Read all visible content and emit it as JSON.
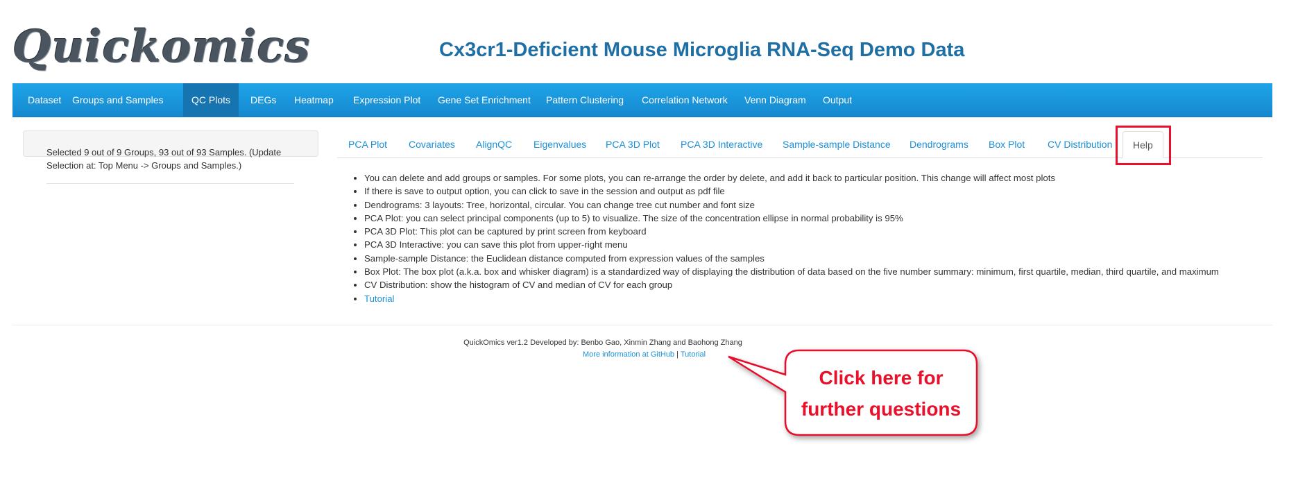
{
  "app": {
    "logo": "Quickomics",
    "title": "Cx3cr1-Deficient Mouse Microglia RNA-Seq Demo Data"
  },
  "nav": {
    "items": [
      "Dataset",
      "Groups and Samples",
      "QC Plots",
      "DEGs",
      "Heatmap",
      "Expression Plot",
      "Gene Set Enrichment",
      "Pattern Clustering",
      "Correlation Network",
      "Venn Diagram",
      "Output"
    ],
    "active": "QC Plots"
  },
  "sidebar": {
    "selection_text": "Selected 9 out of 9 Groups, 93 out of 93 Samples. (Update Selection at: Top Menu -> Groups and Samples.)"
  },
  "tabs": {
    "items": [
      "PCA Plot",
      "Covariates",
      "AlignQC",
      "Eigenvalues",
      "PCA 3D Plot",
      "PCA 3D Interactive",
      "Sample-sample Distance",
      "Dendrograms",
      "Box Plot",
      "CV Distribution",
      "Help"
    ],
    "active": "Help"
  },
  "help": {
    "items": [
      "You can delete and add groups or samples. For some plots, you can re-arrange the order by delete, and add it back to particular position. This change will affect most plots",
      "If there is save to output option, you can click to save in the session and output as pdf file",
      "Dendrograms: 3 layouts: Tree, horizontal, circular. You can change tree cut number and font size",
      "PCA Plot: you can select principal components (up to 5) to visualize. The size of the concentration ellipse in normal probability is 95%",
      "PCA 3D Plot: This plot can be captured by print screen from keyboard",
      "PCA 3D Interactive: you can save this plot from upper-right menu",
      "Sample-sample Distance: the Euclidean distance computed from expression values of the samples",
      "Box Plot: The box plot (a.k.a. box and whisker diagram) is a standardized way of displaying the distribution of data based on the five number summary: minimum, first quartile, median, third quartile, and maximum",
      "CV Distribution: show the histogram of CV and median of CV for each group"
    ],
    "tutorial_link": "Tutorial"
  },
  "footer": {
    "developed_by": "QuickOmics ver1.2 Developed by: Benbo Gao, Xinmin Zhang and Baohong Zhang",
    "github_link": "More information at GitHub",
    "separator": "|",
    "tutorial_link": "Tutorial"
  },
  "annotation": {
    "line1": "Click here for",
    "line2": "further questions",
    "color": "#e8102a"
  },
  "colors": {
    "navbar": "#1a96dc",
    "title": "#1f6fa4",
    "link": "#1a8fd6"
  }
}
